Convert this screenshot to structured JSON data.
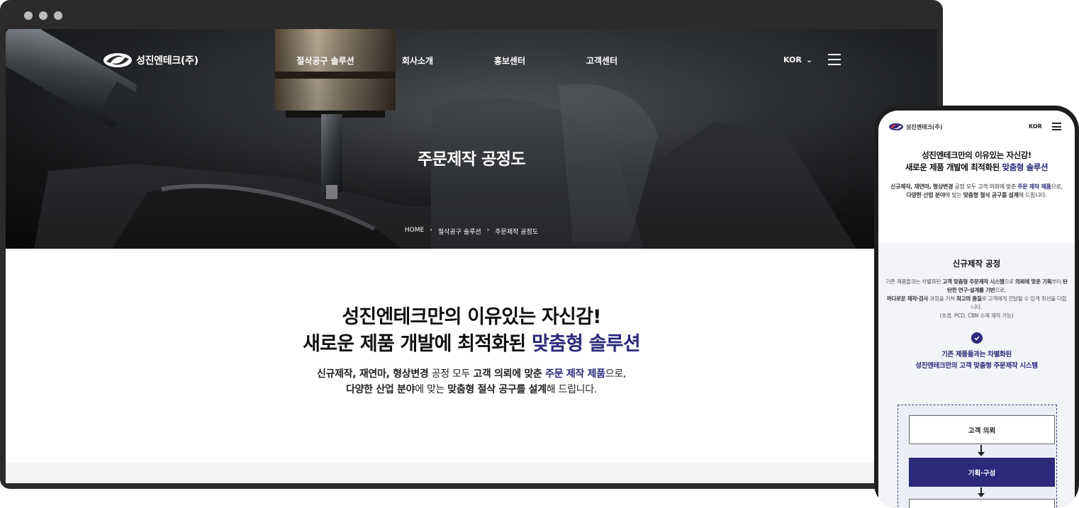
{
  "desktop": {
    "logo_text": "성진엔테크(주)",
    "nav": [
      "절삭공구 솔루션",
      "회사소개",
      "홍보센터",
      "고객센터"
    ],
    "lang": "KOR",
    "lang_caret": "⌄",
    "hero_title": "주문제작 공정도",
    "breadcrumb": [
      "HOME",
      "절삭공구 솔루션",
      "주문제작 공정도"
    ],
    "breadcrumb_sep": "›",
    "intro": {
      "h_line1": "성진엔테크만의 이유있는 자신감!",
      "h_line2_pre": "새로운 제품 개발에 최적화된 ",
      "h_line2_accent": "맞춤형 솔루션",
      "p1_a": "신규제작, 재연마, 형상변경",
      "p1_b": " 공정 모두 ",
      "p1_c": "고객 의뢰에 맞춘 ",
      "p1_d": "주문 제작 제품",
      "p1_e": "으로,",
      "p2_a": "다양한 산업 분야",
      "p2_b": "에 맞는 ",
      "p2_c": "맞춤형 절삭 공구를 설계",
      "p2_d": "해 드립니다."
    }
  },
  "mobile": {
    "logo_text": "성진엔테크(주)",
    "lang": "KOR",
    "h_line1": "성진엔테크만의 이유있는 자신감!",
    "h_line2_pre": "새로운 제품 개발에 최적화된 ",
    "h_line2_accent": "맞춤형 솔루션",
    "p_a": "신규제작, 재연마, 형상변경",
    "p_b": " 공정 모두 고객 의뢰에 맞춘 ",
    "p_c": "주문 제작 제품",
    "p_d": "으로,",
    "p_e": "다양한 산업 분야",
    "p_f": "에 맞는 ",
    "p_g": "맞춤형 절삭 공구를 설계",
    "p_h": "해 드립니다.",
    "section_title": "신규제작 공정",
    "desc_1a": "기존 제품들과는 차별화된 ",
    "desc_1b": "고객 맞춤형 주문제작 시스템",
    "desc_1c": "으로 ",
    "desc_1d": "의뢰에 맞춘 기획",
    "desc_1e": "부터 ",
    "desc_1f": "탄탄한 연구·설계를 기반",
    "desc_1g": "으로,",
    "desc_2a": "까다로운 제작·검사",
    "desc_2b": " 과정을 거쳐 ",
    "desc_2c": "최고의 품질",
    "desc_2d": "로 고객에게 전달될 수 있게 최선을 다합니다.",
    "desc_3": "(초경, PCD, CBN 소재 제작 가능)",
    "system_line1": "기존 제품들과는 차별화된",
    "system_line2": "성진엔테크만의 고객 맞춤형 주문제작 시스템",
    "steps": [
      "고객 의뢰",
      "기획·구성"
    ]
  },
  "colors": {
    "accent": "#2b2a7b",
    "frame": "#2b2b2b",
    "band": "#f4f4f6"
  }
}
